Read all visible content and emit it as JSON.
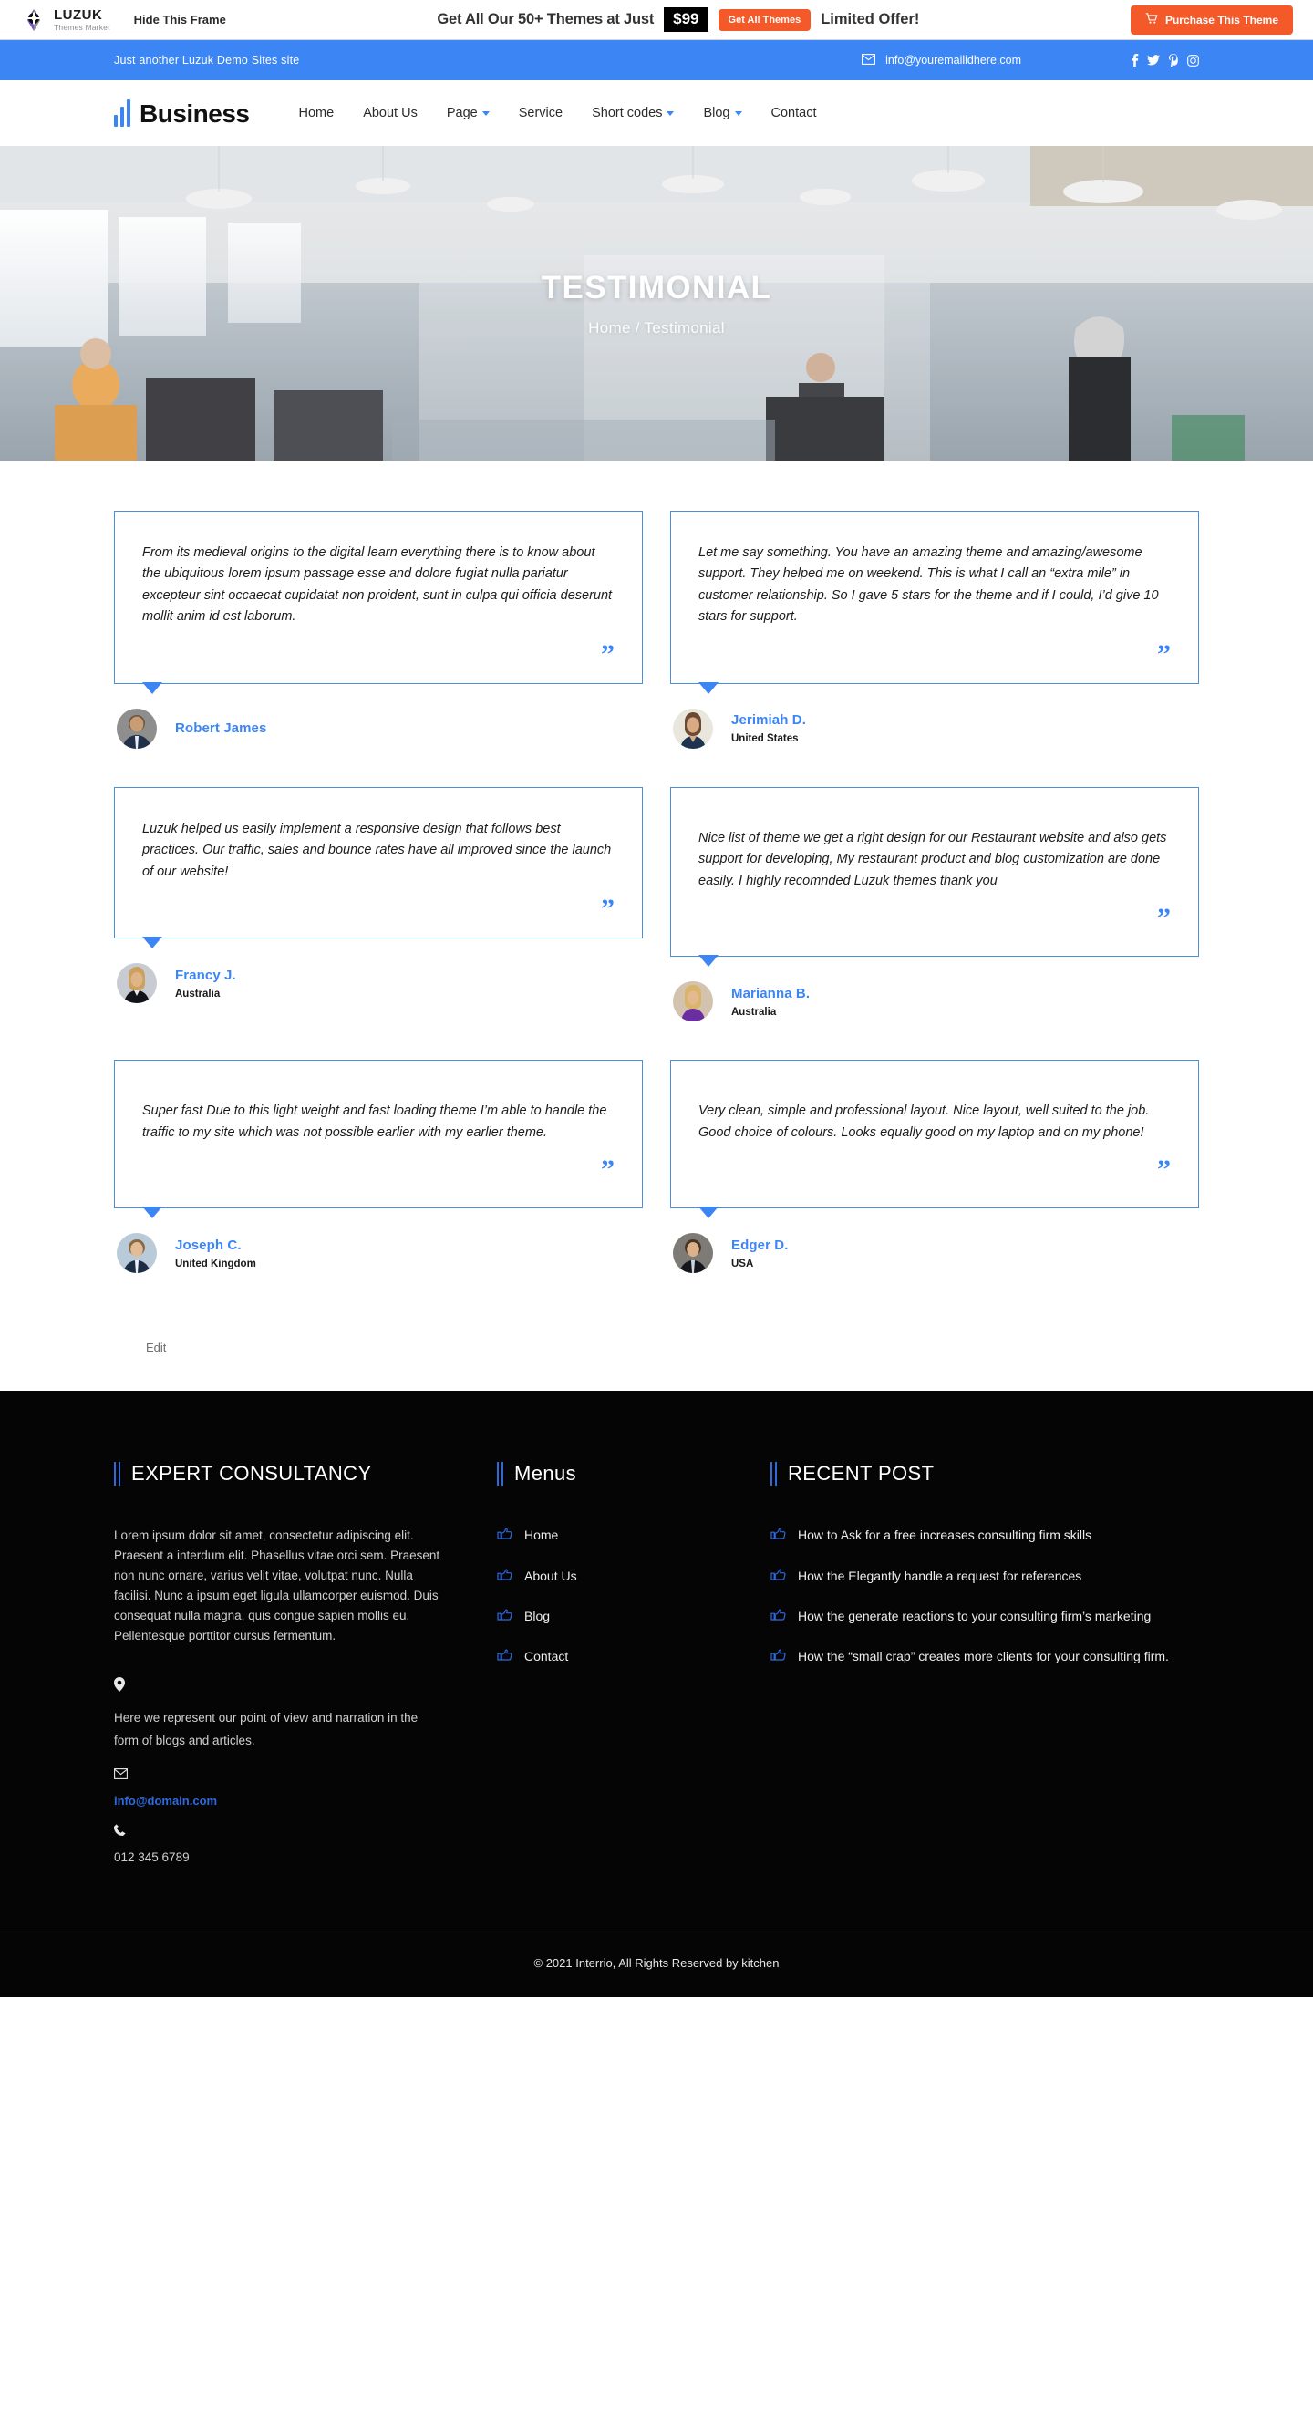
{
  "frame_bar": {
    "logo_title": "LUZUK",
    "logo_subtitle": "Themes Market",
    "hide_frame": "Hide This Frame",
    "promo_text": "Get All Our 50+ Themes at Just",
    "promo_price": "$99",
    "get_all_themes": "Get All Themes",
    "limited_offer": "Limited Offer!",
    "purchase_button": "Purchase This Theme",
    "accent_color": "#f4592a"
  },
  "topbar": {
    "tagline": "Just another Luzuk Demo Sites site",
    "email": "info@youremailidhere.com",
    "background_color": "#3c85f5",
    "social": [
      "facebook-icon",
      "twitter-icon",
      "pinterest-icon",
      "instagram-icon"
    ]
  },
  "nav": {
    "brand": "Business",
    "items": [
      {
        "label": "Home",
        "has_dropdown": false
      },
      {
        "label": "About Us",
        "has_dropdown": false
      },
      {
        "label": "Page",
        "has_dropdown": true
      },
      {
        "label": "Service",
        "has_dropdown": false
      },
      {
        "label": "Short codes",
        "has_dropdown": true
      },
      {
        "label": "Blog",
        "has_dropdown": true
      },
      {
        "label": "Contact",
        "has_dropdown": false
      }
    ]
  },
  "hero": {
    "title": "TESTIMONIAL",
    "breadcrumb_home": "Home",
    "breadcrumb_sep": "/",
    "breadcrumb_current": "Testimonial"
  },
  "testimonials": [
    {
      "text": "From its medieval origins to the digital learn everything there is to know about the ubiquitous lorem ipsum passage esse and dolore fugiat nulla pariatur excepteur sint occaecat cupidatat non proident, sunt in culpa qui officia deserunt mollit anim id est laborum.",
      "name": "Robert James",
      "place": "",
      "avatar": "avatar-man-1"
    },
    {
      "text": "Let me say something. You have an amazing theme and amazing/awesome support. They helped me on weekend. This is what I call an “extra mile” in customer relationship. So I gave 5 stars for the theme and if I could, I’d give 10 stars for support.",
      "name": "Jerimiah D.",
      "place": "United States",
      "avatar": "avatar-woman-1"
    },
    {
      "text": "Luzuk helped us easily implement a responsive design that follows best practices. Our traffic, sales and bounce rates have all improved since the launch of our website!",
      "name": "Francy J.",
      "place": "Australia",
      "avatar": "avatar-woman-2"
    },
    {
      "text": "Nice list of theme we get a right design for our Restaurant website and also gets support for developing, My restaurant product and blog customization are done easily. I highly recomnded Luzuk themes thank you",
      "name": "Marianna B.",
      "place": "Australia",
      "avatar": "avatar-woman-3"
    },
    {
      "text": "Super fast Due to this light weight and fast loading theme I’m able to handle the traffic to my site which was not possible earlier with my earlier theme.",
      "name": "Joseph C.",
      "place": "United Kingdom",
      "avatar": "avatar-man-2"
    },
    {
      "text": "Very clean, simple and professional layout. Nice layout, well suited to the job. Good choice of colours. Looks equally good on my laptop and on my phone!",
      "name": "Edger D.",
      "place": "USA",
      "avatar": "avatar-man-3"
    }
  ],
  "quote_glyph": "”",
  "edit_link": "Edit",
  "footer": {
    "col1": {
      "heading": "EXPERT CONSULTANCY",
      "paragraph": "Lorem ipsum dolor sit amet, consectetur adipiscing elit. Praesent a interdum elit. Phasellus vitae orci sem. Praesent non nunc ornare, varius velit vitae, volutpat nunc. Nulla facilisi. Nunc a ipsum eget ligula ullamcorper euismod. Duis consequat nulla magna, quis congue sapien mollis eu. Pellentesque porttitor cursus fermentum.",
      "address": "Here we represent our point of view and narration in the form of blogs and articles.",
      "email": "info@domain.com",
      "phone": "012 345 6789"
    },
    "col2": {
      "heading": "Menus",
      "items": [
        "Home",
        "About Us",
        "Blog",
        "Contact"
      ]
    },
    "col3": {
      "heading": "RECENT POST",
      "items": [
        "How to Ask for a free increases consulting firm skills",
        "How the Elegantly handle a request for references",
        "How the generate reactions to your consulting firm’s marketing",
        "How the “small crap” creates more clients for your consulting firm."
      ]
    },
    "copyright": "© 2021 Interrio, All Rights Reserved by kitchen",
    "accent_color": "#2d6ae0"
  }
}
